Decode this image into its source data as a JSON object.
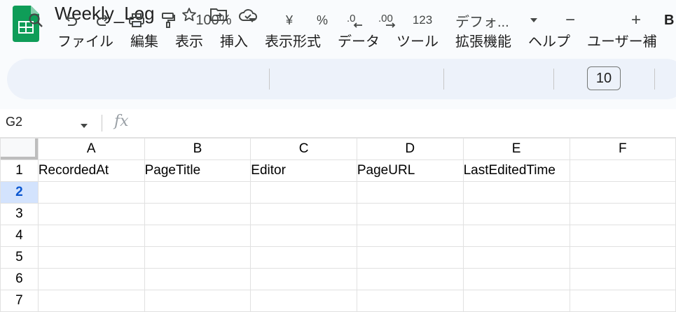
{
  "app": {
    "doc_title": "Weekly_Log",
    "brand_color": "#0f9d58",
    "title_icons": [
      "star-icon",
      "move-to-folder-icon",
      "cloud-saved-icon"
    ]
  },
  "menu": [
    "ファイル",
    "編集",
    "表示",
    "挿入",
    "表示形式",
    "データ",
    "ツール",
    "拡張機能",
    "ヘルプ",
    "ユーザー補"
  ],
  "toolbar": {
    "zoom": "100%",
    "currency": "¥",
    "percent": "%",
    "more_formats": "123",
    "font": "デフォ...",
    "font_size": "10",
    "minus": "−",
    "plus": "+",
    "bold": "B"
  },
  "formula_bar": {
    "cell_ref": "G2",
    "fx_label": "fx",
    "value": ""
  },
  "sheet": {
    "columns": [
      "A",
      "B",
      "C",
      "D",
      "E",
      "F"
    ],
    "rows": [
      "1",
      "2",
      "3",
      "4",
      "5",
      "6",
      "7"
    ],
    "selected_row": "2",
    "header_row": [
      "RecordedAt",
      "PageTitle",
      "Editor",
      "PageURL",
      "LastEditedTime",
      ""
    ]
  }
}
